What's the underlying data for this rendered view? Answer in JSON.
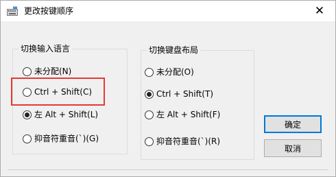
{
  "window": {
    "title": "更改按键顺序",
    "close_glyph": "✕"
  },
  "input_language": {
    "group_label": "切换输入语言",
    "options": [
      {
        "label": "未分配(N)",
        "checked": false
      },
      {
        "label": "Ctrl + Shift(C)",
        "checked": false
      },
      {
        "label": "左 Alt + Shift(L)",
        "checked": true
      },
      {
        "label": "抑音符重音(`)(G)",
        "checked": false
      }
    ]
  },
  "keyboard_layout": {
    "group_label": "切换键盘布局",
    "options": [
      {
        "label": "未分配(O)",
        "checked": false
      },
      {
        "label": "Ctrl + Shift(T)",
        "checked": true
      },
      {
        "label": "左 Alt + Shift(F)",
        "checked": false
      },
      {
        "label": "抑音符重音(`)(R)",
        "checked": false
      }
    ]
  },
  "buttons": {
    "ok": "确定",
    "cancel": "取消"
  },
  "colors": {
    "highlight": "#e53935",
    "default_button_border": "#0078d7"
  }
}
